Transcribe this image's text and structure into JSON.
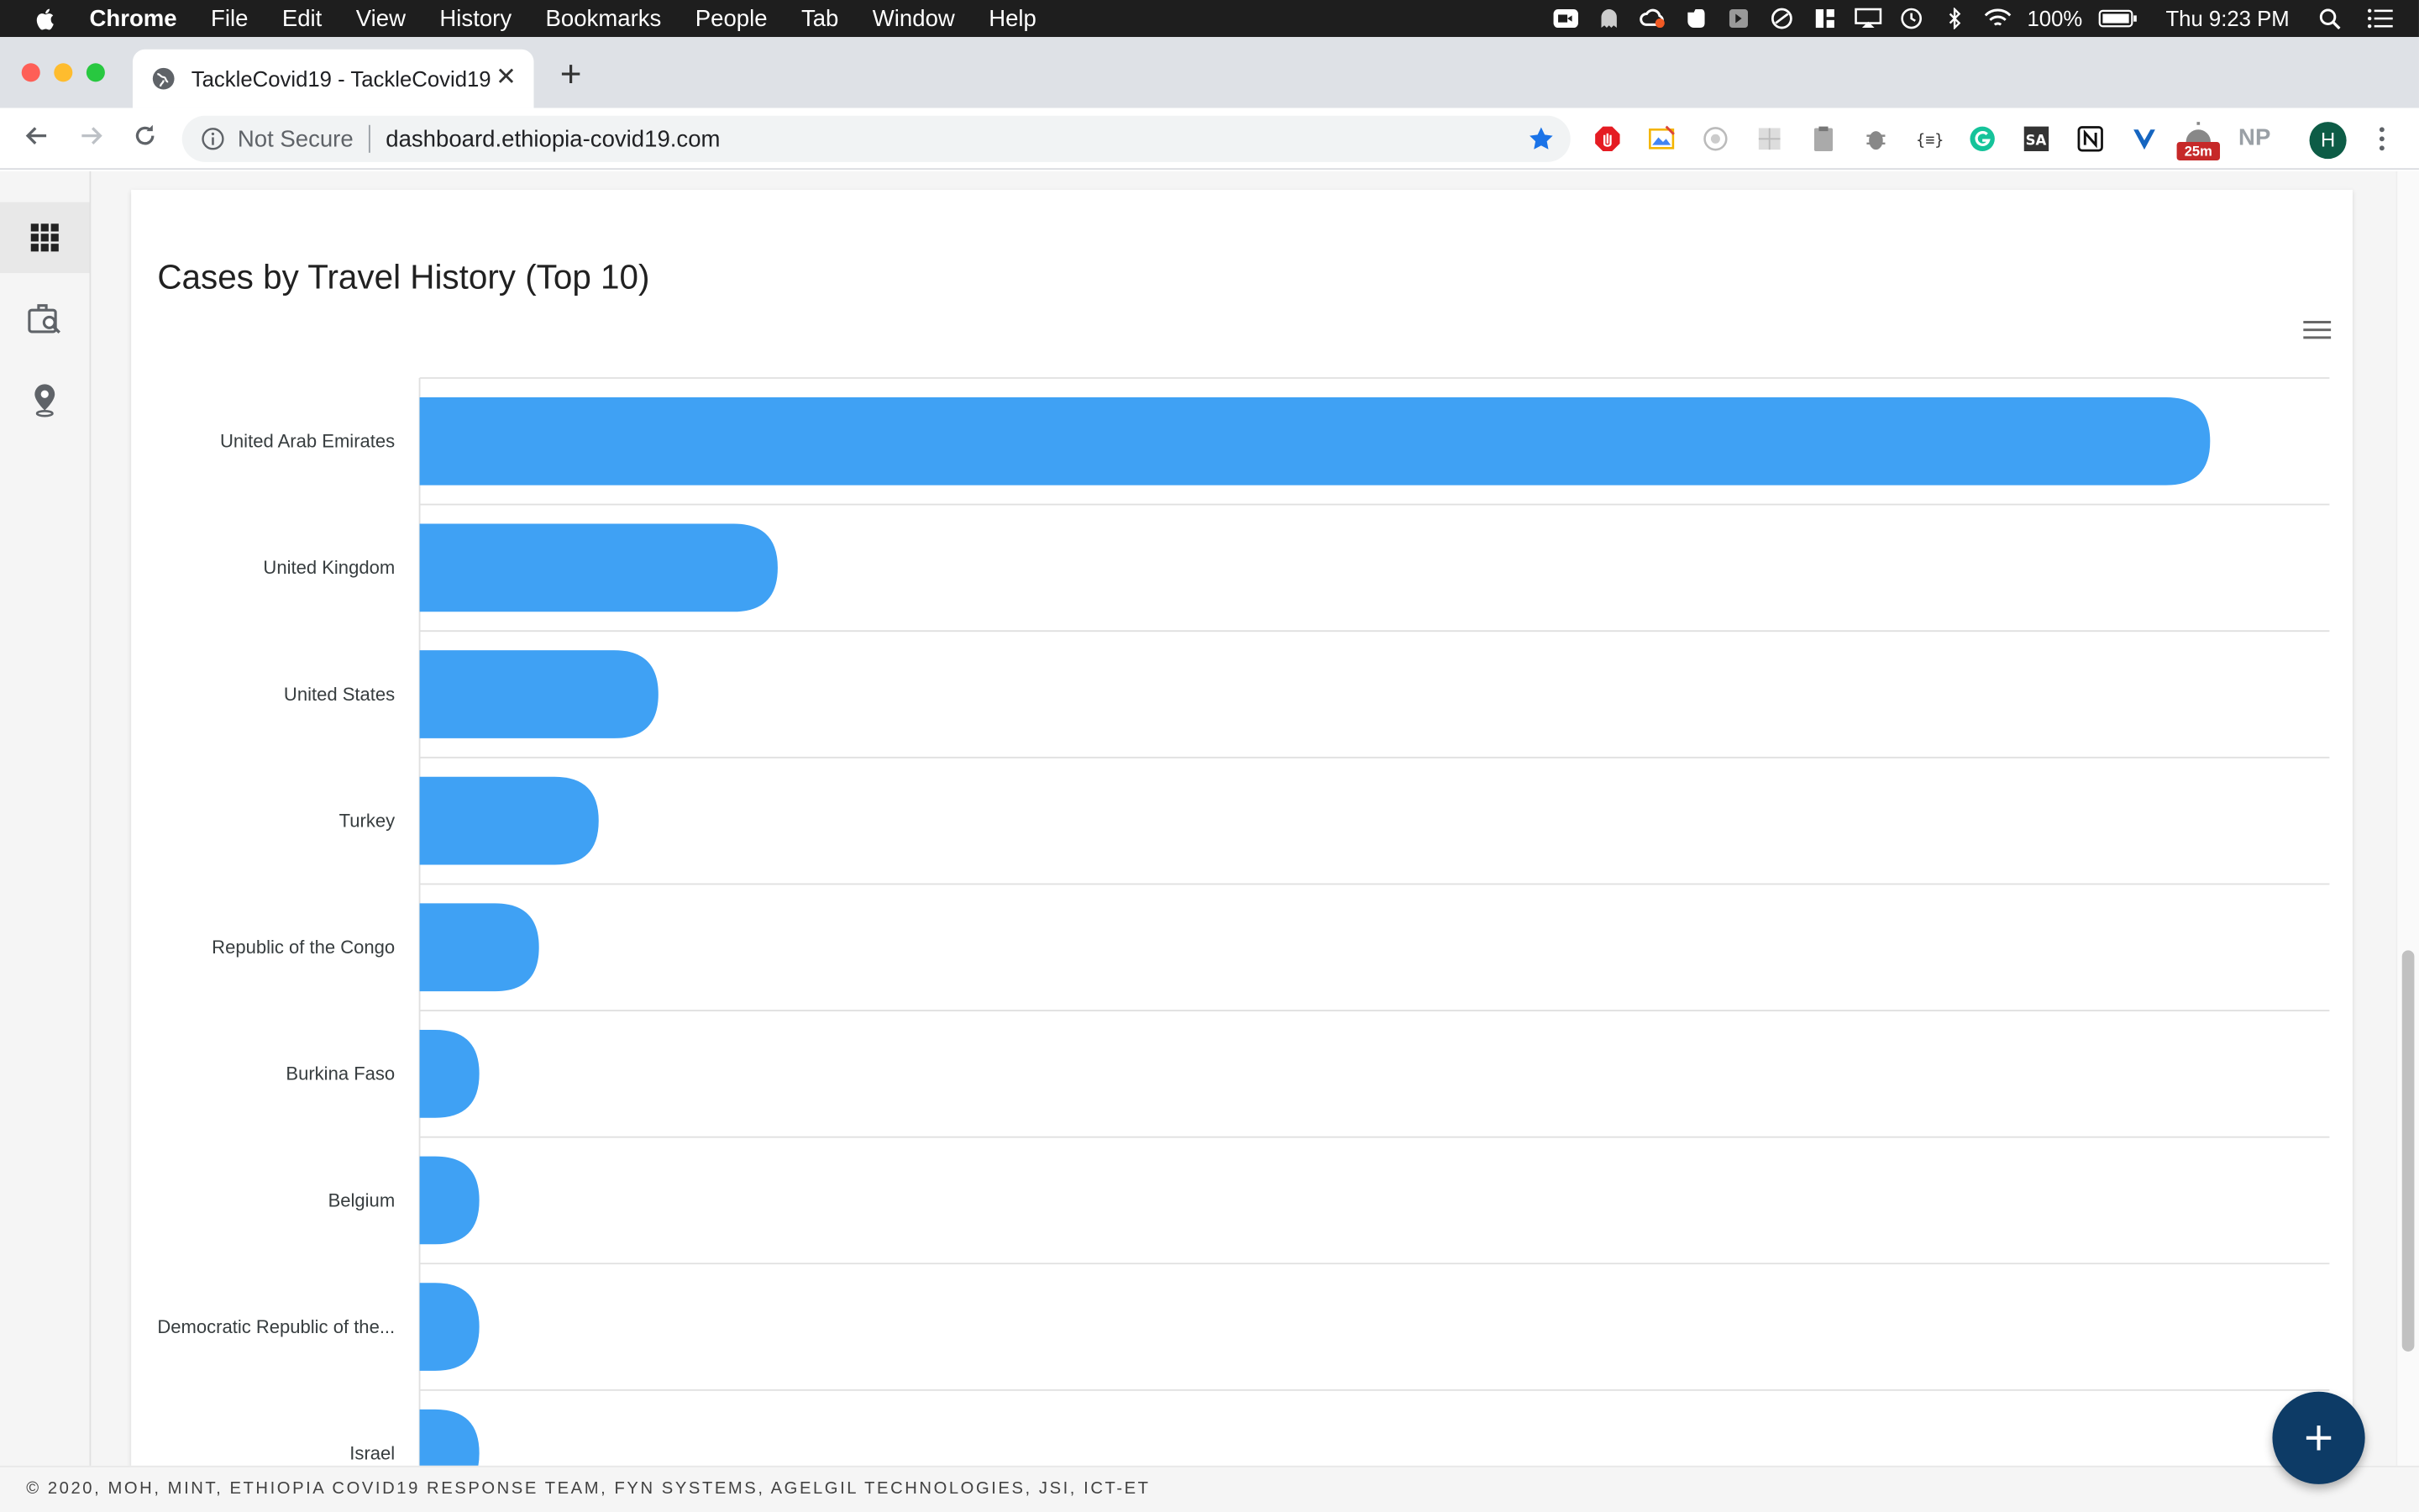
{
  "menubar": {
    "app_name": "Chrome",
    "items": [
      "File",
      "Edit",
      "View",
      "History",
      "Bookmarks",
      "People",
      "Tab",
      "Window",
      "Help"
    ],
    "battery": "100%",
    "clock": "Thu 9:23 PM"
  },
  "browser": {
    "tab_title": "TackleCovid19 - TackleCovid19",
    "security_label": "Not Secure",
    "url": "dashboard.ethiopia-covid19.com",
    "extension_badge": "25m",
    "extension_np": "NP",
    "profile_initial": "H"
  },
  "sidenav": {
    "items": [
      "apps-grid-icon",
      "case-search-icon",
      "location-pin-icon"
    ]
  },
  "card": {
    "title": "Cases by Travel History (Top 10)"
  },
  "chart_data": {
    "type": "bar",
    "orientation": "horizontal",
    "title": "Cases by Travel History (Top 10)",
    "categories": [
      "United Arab Emirates",
      "United Kingdom",
      "United States",
      "Turkey",
      "Republic of the Congo",
      "Burkina Faso",
      "Belgium",
      "Democratic Republic of the...",
      "Israel"
    ],
    "values": [
      30,
      6,
      4,
      3,
      2,
      1,
      1,
      1,
      1
    ],
    "xlim": [
      0,
      32
    ],
    "grid": true,
    "bar_color": "#3fa1f4"
  },
  "footer": {
    "text": "© 2020, MOH, MINT, ETHIOPIA COVID19 RESPONSE TEAM, FYN SYSTEMS, AGELGIL TECHNOLOGIES, JSI, ICT-ET"
  },
  "colors": {
    "accent": "#3fa1f4",
    "fab": "#0d3b66"
  }
}
